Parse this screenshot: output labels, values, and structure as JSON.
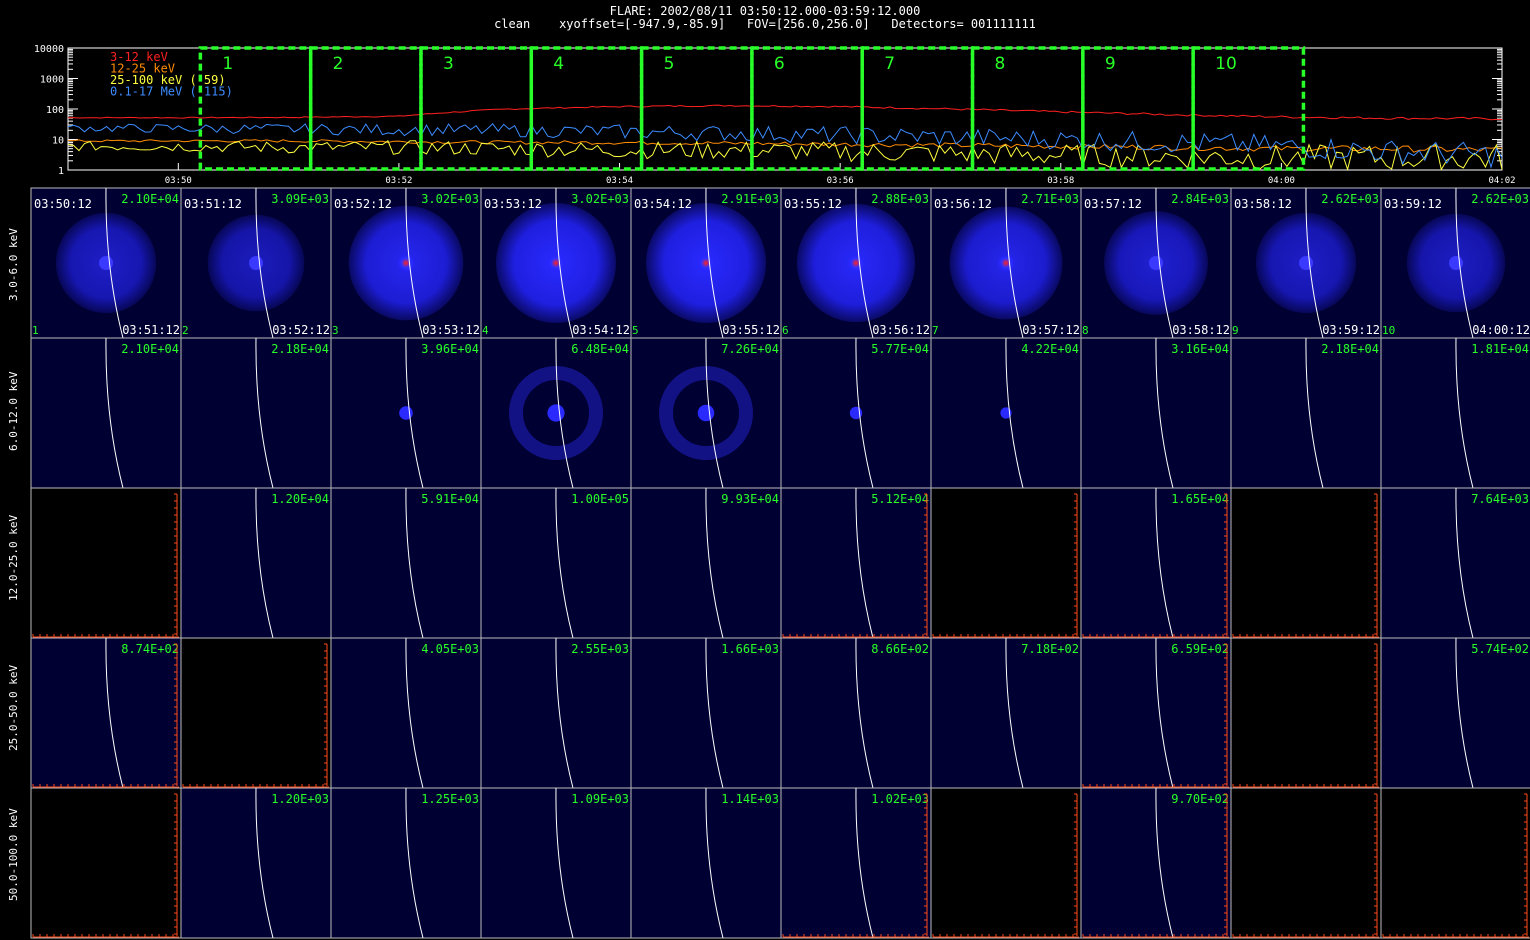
{
  "header": {
    "line1": "FLARE: 2002/08/11 03:50:12.000-03:59:12.000",
    "line2": "clean    xyoffset=[-947.9,-85.9]   FOV=[256.0,256.0]   Detectors= 001111111"
  },
  "lightcurve": {
    "y_ticks": [
      "10000",
      "1000",
      "100",
      "10",
      "1"
    ],
    "x_ticks": [
      "03:50",
      "03:52",
      "03:54",
      "03:56",
      "03:58",
      "04:00",
      "04:02"
    ],
    "legend": [
      {
        "label": "3-12 keV",
        "color": "#ff2020"
      },
      {
        "label": "12-25 keV",
        "color": "#ff8c00"
      },
      {
        "label": "25-100 keV (-59)",
        "color": "#ffff40"
      },
      {
        "label": "0.1-17 MeV (-115)",
        "color": "#3c8cff"
      }
    ],
    "interval_labels": [
      "1",
      "2",
      "3",
      "4",
      "5",
      "6",
      "7",
      "8",
      "9",
      "10"
    ],
    "interval_color": "#28ff28"
  },
  "chart_data": {
    "type": "line",
    "title": "FLARE: 2002/08/11 03:50:12.000-03:59:12.000",
    "x_range": [
      "03:49:00",
      "04:02:00"
    ],
    "y_scale": "log",
    "ylim": [
      1,
      10000
    ],
    "x": [
      "03:49",
      "03:50",
      "03:51",
      "03:52",
      "03:53",
      "03:54",
      "03:55",
      "03:56",
      "03:57",
      "03:58",
      "03:59",
      "04:00",
      "04:01",
      "04:02"
    ],
    "series": [
      {
        "name": "3-12 keV",
        "color": "#ff2020",
        "values": [
          52,
          52,
          53,
          58,
          100,
          120,
          130,
          120,
          100,
          80,
          65,
          55,
          50,
          48
        ]
      },
      {
        "name": "12-25 keV",
        "color": "#ff8c00",
        "values": [
          9,
          9,
          9,
          8.5,
          8,
          8,
          7.5,
          7,
          6.5,
          6,
          5.5,
          5,
          5,
          4.5
        ]
      },
      {
        "name": "25-100 keV (-59)",
        "color": "#ffff40",
        "values": [
          6,
          6,
          5.5,
          5.5,
          5,
          4.5,
          4.5,
          4,
          3.5,
          3,
          2.8,
          2.5,
          2.5,
          2.5
        ]
      },
      {
        "name": "0.1-17 MeV (-115)",
        "color": "#3c8cff",
        "values": [
          24,
          23,
          22,
          21,
          20,
          18,
          16,
          14,
          12,
          10,
          8,
          6,
          4,
          3
        ]
      }
    ],
    "intervals": [
      {
        "label": "1",
        "start": "03:50:12",
        "end": "03:51:12"
      },
      {
        "label": "2",
        "start": "03:51:12",
        "end": "03:52:12"
      },
      {
        "label": "3",
        "start": "03:52:12",
        "end": "03:53:12"
      },
      {
        "label": "4",
        "start": "03:53:12",
        "end": "03:54:12"
      },
      {
        "label": "5",
        "start": "03:54:12",
        "end": "03:55:12"
      },
      {
        "label": "6",
        "start": "03:55:12",
        "end": "03:56:12"
      },
      {
        "label": "7",
        "start": "03:56:12",
        "end": "03:57:12"
      },
      {
        "label": "8",
        "start": "03:57:12",
        "end": "03:58:12"
      },
      {
        "label": "9",
        "start": "03:58:12",
        "end": "03:59:12"
      },
      {
        "label": "10",
        "start": "03:59:12",
        "end": "04:00:12"
      }
    ]
  },
  "images": {
    "start_times": [
      "03:50:12",
      "03:51:12",
      "03:52:12",
      "03:53:12",
      "03:54:12",
      "03:55:12",
      "03:56:12",
      "03:57:12",
      "03:58:12",
      "03:59:12"
    ],
    "end_times": [
      "03:51:12",
      "03:52:12",
      "03:53:12",
      "03:54:12",
      "03:55:12",
      "03:56:12",
      "03:57:12",
      "03:58:12",
      "03:59:12",
      "04:00:12"
    ],
    "index_labels": [
      "1",
      "2",
      "3",
      "4",
      "5",
      "6",
      "7",
      "8",
      "9",
      "10"
    ],
    "rows": [
      {
        "energy": "3.0-6.0 keV",
        "peaks": [
          "2.10E+04",
          "3.09E+03",
          "3.02E+03",
          "3.02E+03",
          "2.91E+03",
          "2.88E+03",
          "2.71E+03",
          "2.84E+03",
          "2.62E+03",
          "2.62E+03"
        ],
        "source": [
          0.45,
          0.35,
          0.85,
          1.0,
          1.0,
          0.95,
          0.8,
          0.55,
          0.45,
          0.4
        ]
      },
      {
        "energy": "6.0-12.0 keV",
        "peaks": [
          "2.10E+04",
          "2.18E+04",
          "3.96E+04",
          "6.48E+04",
          "7.26E+04",
          "5.77E+04",
          "4.22E+04",
          "3.16E+04",
          "2.18E+04",
          "1.81E+04"
        ],
        "source": [
          0,
          0,
          0.3,
          0.6,
          0.55,
          0.2,
          0.1,
          0,
          0,
          0
        ]
      },
      {
        "energy": "12.0-25.0 keV",
        "peaks": [
          "",
          "1.20E+04",
          "5.91E+04",
          "1.00E+05",
          "9.93E+04",
          "5.12E+04",
          "",
          "1.65E+04",
          "",
          "7.64E+03"
        ],
        "source": [
          0,
          0,
          0,
          0,
          0,
          0,
          0,
          0,
          0,
          0
        ]
      },
      {
        "energy": "25.0-50.0 keV",
        "peaks": [
          "8.74E+02",
          "",
          "4.05E+03",
          "2.55E+03",
          "1.66E+03",
          "8.66E+02",
          "7.18E+02",
          "6.59E+02",
          "",
          "5.74E+02"
        ],
        "source": [
          0,
          0,
          0,
          0,
          0,
          0,
          0,
          0,
          0,
          0
        ]
      },
      {
        "energy": "50.0-100.0 keV",
        "peaks": [
          "",
          "1.20E+03",
          "1.25E+03",
          "1.09E+03",
          "1.14E+03",
          "1.02E+03",
          "",
          "9.70E+02",
          "",
          ""
        ],
        "source": [
          0,
          0,
          0,
          0,
          0,
          0,
          0,
          0,
          0,
          0
        ]
      }
    ],
    "colors": {
      "panel_bg": "#000033",
      "empty_bg": "#000000",
      "peak_text": "#28ff28",
      "axis_red": "#ff4a1a",
      "limb": "#ffffff"
    }
  }
}
